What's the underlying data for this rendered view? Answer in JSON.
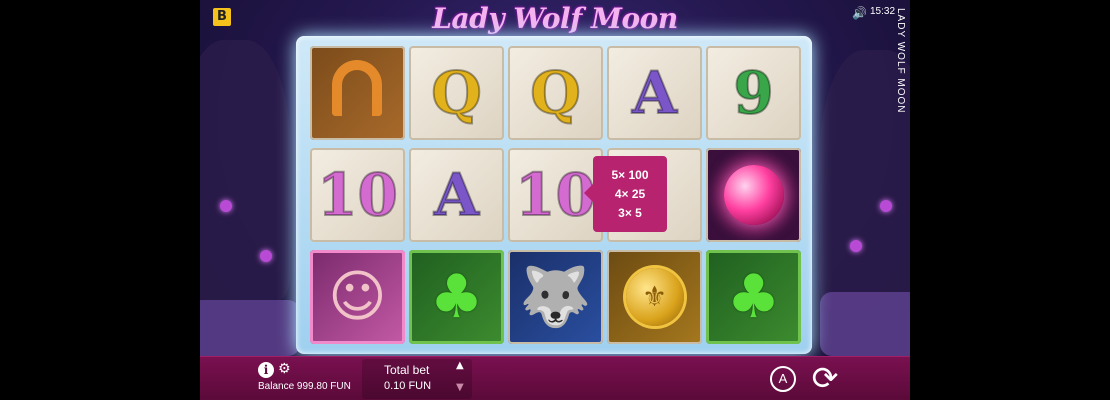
{
  "header": {
    "brand_logo_text": "B",
    "title": "Lady Wolf Moon",
    "time": "15:32",
    "vertical_title": "LADY WOLF MOON",
    "speaker_icon": "speaker-icon"
  },
  "reels": [
    [
      {
        "symbol": "horseshoe",
        "text": ""
      },
      {
        "symbol": "Q",
        "text": "Q",
        "color": "#e2b21d"
      },
      {
        "symbol": "Q",
        "text": "Q",
        "color": "#e2b21d"
      },
      {
        "symbol": "A",
        "text": "A",
        "color": "#7a56c9"
      },
      {
        "symbol": "9",
        "text": "9",
        "color": "#3aa64a"
      }
    ],
    [
      {
        "symbol": "10",
        "text": "10",
        "color": "#d36bd0"
      },
      {
        "symbol": "A",
        "text": "A",
        "color": "#7a56c9"
      },
      {
        "symbol": "10",
        "text": "10",
        "color": "#d36bd0"
      },
      {
        "symbol": "hidden",
        "text": ""
      },
      {
        "symbol": "pink-orb",
        "text": ""
      }
    ],
    [
      {
        "symbol": "lady",
        "text": ""
      },
      {
        "symbol": "clover",
        "text": ""
      },
      {
        "symbol": "wolf",
        "text": ""
      },
      {
        "symbol": "coin",
        "text": ""
      },
      {
        "symbol": "clover",
        "text": ""
      }
    ]
  ],
  "paytable": {
    "lines": [
      "5× 100",
      "4× 25",
      "3× 5"
    ]
  },
  "bottom_bar": {
    "info_icon": "info-icon",
    "settings_icon": "gear-icon",
    "balance": "Balance 999.80 FUN",
    "total_bet_label": "Total bet",
    "total_bet_value": "0.10 FUN",
    "bet_up_icon": "caret-up-icon",
    "bet_down_icon": "caret-down-icon",
    "autoplay_label": "A",
    "spin_icon": "spin-icon"
  }
}
